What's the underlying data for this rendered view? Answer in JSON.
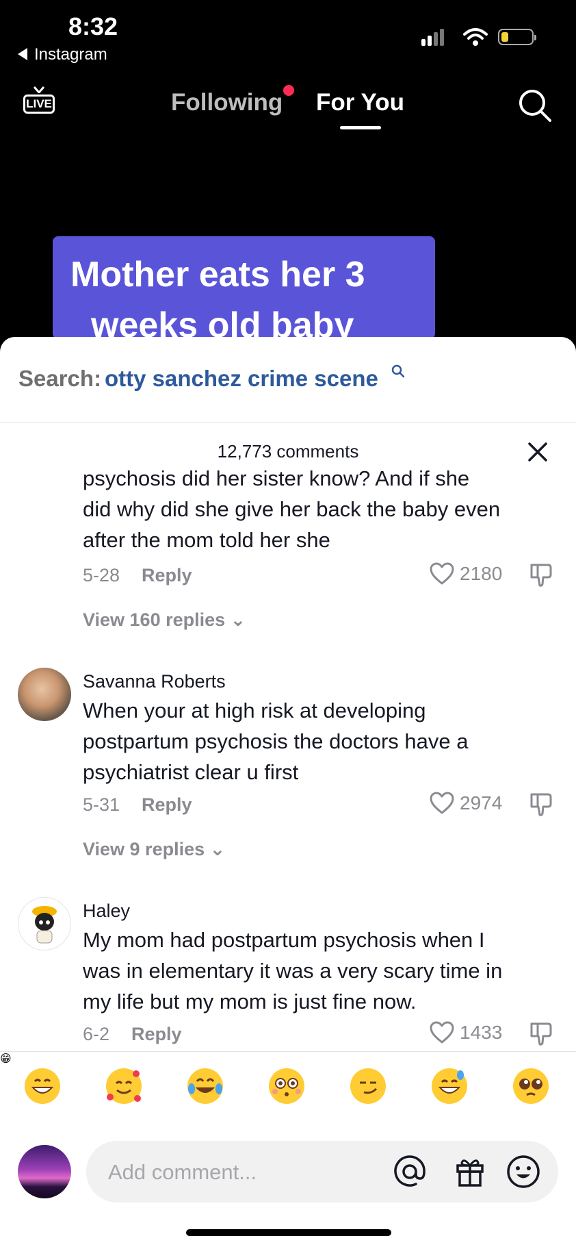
{
  "status_bar": {
    "time": "8:32",
    "back_app": "Instagram"
  },
  "top_nav": {
    "live_label": "LIVE",
    "tabs": [
      "Following",
      "For You"
    ],
    "active_tab": "For You",
    "search_icon": "search-icon"
  },
  "video": {
    "caption_line1": "Mother eats her 3",
    "caption_line2": "weeks old baby"
  },
  "search_suggest": {
    "prefix": "Search:",
    "term": "otty sanchez crime scene"
  },
  "comments_header": {
    "count": "12,773 comments"
  },
  "comments": [
    {
      "text_lines": [
        "psychosis did her sister know? And if she",
        "did why did she give her back the baby even",
        "after the mom told her she"
      ],
      "date": "5-28",
      "reply": "Reply",
      "likes": "2180",
      "view_replies": "View 160 replies"
    },
    {
      "user": "Savanna Roberts",
      "text_lines": [
        "When your at high risk at developing",
        "postpartum psychosis the doctors have a",
        "psychiatrist clear u first"
      ],
      "date": "5-31",
      "reply": "Reply",
      "likes": "2974",
      "view_replies": "View 9 replies"
    },
    {
      "user": "Haley",
      "text_lines": [
        "My mom had postpartum psychosis when I",
        "was in elementary it was a very scary time in",
        "my life but my mom is just fine now."
      ],
      "date": "6-2",
      "reply": "Reply",
      "likes": "1433"
    }
  ],
  "emoji_bar": [
    "😁",
    "🥰",
    "😂",
    "😳",
    "😏",
    "😅",
    "🥺"
  ],
  "composer": {
    "placeholder": "Add comment..."
  },
  "colors": {
    "accent": "#fe2c55",
    "search_term": "#2e5a9c",
    "banner": "#5a55d8"
  }
}
